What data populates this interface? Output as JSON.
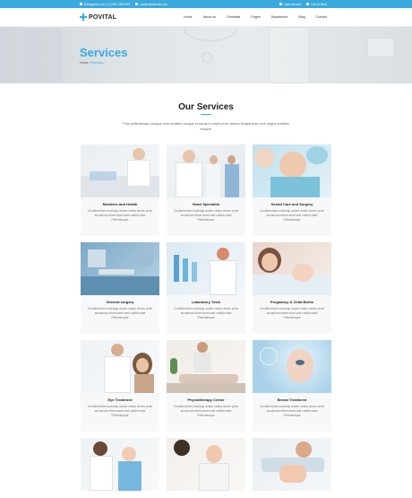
{
  "topbar": {
    "phone": "Emergency Line: (+1) 961-765-9370",
    "email": "contact@domain.com",
    "account": "User Account",
    "cart": "Cart (0 item)"
  },
  "nav": {
    "logo": "POVITAL",
    "items": [
      "Home",
      "About us",
      "Timetable",
      "Pages",
      "Department",
      "Blog",
      "Contact"
    ]
  },
  "hero": {
    "title": "Services",
    "breadcrumb_home": "Home",
    "breadcrumb_sep": "/",
    "breadcrumb_current": "Services"
  },
  "section": {
    "title": "Our Services",
    "subtitle": "Puis pellentesque congue eum sodales congue et purus in turpis proin dictum feugiat plius nich augue sodales congue."
  },
  "cards": [
    {
      "title": "Medicine and Health",
      "text": "Condimentum sociosqu auctor varius donec proin accumsan etiam amet and cubilia vitae Pellentesque"
    },
    {
      "title": "Heart Specialist",
      "text": "Condimentum sociosqu auctor varius donec proin accumsan etiam amet and cubilia vitae Pellentesque"
    },
    {
      "title": "Dental Care and Surgery",
      "text": "Condimentum sociosqu auctor varius donec proin accumsan etiam amet and cubilia vitae Pellentesque"
    },
    {
      "title": "General surgery",
      "text": "Condimentum sociosqu auctor varius donec proin accumsan etiam amet and cubilia vitae Pellentesque"
    },
    {
      "title": "Laboratory Tests",
      "text": "Condimentum sociosqu auctor varius donec proin accumsan etiam amet and cubilia vitae Pellentesque"
    },
    {
      "title": "Pregnancy & Child Births",
      "text": "Condimentum sociosqu auctor varius donec proin accumsan etiam amet and cubilia vitae Pellentesque"
    },
    {
      "title": "Eye Treatment",
      "text": "Condimentum sociosqu auctor varius donec proin accumsan etiam amet and cubilia vitae Pellentesque"
    },
    {
      "title": "Physiotherapy Center",
      "text": "Condimentum sociosqu auctor varius donec proin accumsan etiam amet and cubilia vitae Pellentesque"
    },
    {
      "title": "Breast Treatment",
      "text": "Condimentum sociosqu auctor varius donec proin accumsan etiam amet and cubilia vitae Pellentesque"
    },
    {
      "title": "",
      "text": ""
    },
    {
      "title": "",
      "text": ""
    },
    {
      "title": "",
      "text": ""
    }
  ],
  "colors": {
    "accent": "#3aa9de"
  }
}
